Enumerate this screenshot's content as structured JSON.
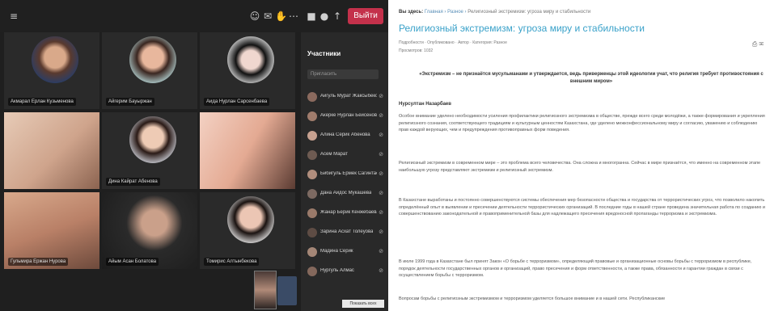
{
  "call": {
    "toolbar": {
      "leave_label": "Выйти"
    },
    "panel": {
      "title": "Участники",
      "search_placeholder": "Пригласить",
      "participants": [
        "Айгуль Мурат Жаксыбекова",
        "Акерке Нурлан Бейсенова",
        "Алина Серик Абенова",
        "Асем Марат",
        "Бибигуль Ермек Сагинтаева",
        "Дана Айдос Мукашева",
        "Жанар Берик Кенжебаева",
        "Зарина Асхат Толеуова",
        "Мадина Серик",
        "Нургуль Алмас"
      ]
    },
    "tiles": [
      "Акмарал Ерлан Кузьменова",
      "Айгерим Бауыржан",
      "Аида Нурлан Сарсенбаева",
      "",
      "Дина Кайрат Абенова",
      "",
      "Гульмира Ержан Нурова",
      "Айым Асан Болатова",
      "Томирис Алтынбекова"
    ],
    "tooltip": "Показать всех"
  },
  "article": {
    "breadcrumb": [
      "Вы здесь:",
      "Главная",
      "Разное",
      "Религиозный экстремизм: угроза миру и стабильности"
    ],
    "title": "Религиозный экстремизм: угроза миру и стабильности",
    "meta": "Подробности · Опубликовано · Автор · Категория: Разное",
    "views": "Просмотров: 1032",
    "abstract": "«Экстремизм – не признаётся мусульманами и утверждается, ведь приверженцы этой идеологии учат, что религия требует противостояния с внешним миром»",
    "author": "Нурсултан Назарбаев",
    "paragraphs": [
      "Особое внимание уделено необходимости усиления профилактики религиозного экстремизма в обществе, прежде всего среди молодёжи, а также формирования и укрепления религиозного сознания, соответствующего традициям и культурным ценностям Казахстана, где уделено межконфессиональному миру и согласию, уважению и соблюдению прав каждой верующих, чем и предупреждения противоправных форм поведения.",
      "Религиозный экстремизм в современном мире – это проблема всего человечества. Она сложна и многогранна. Сейчас в мире признаётся, что именно на современном этапе наибольшую угрозу представляют экстремизм и религиозный экстремизм.",
      "В Казахстане выработаны и постоянно совершенствуются системы обеспечения мер безопасности общества и государства от террористических угроз, что позволило накопить определённый опыт в выявлении и пресечении деятельности террористических организаций. В последние годы в нашей стране проведена значительная работа по созданию и совершенствованию законодательной и правоприменительной базы для надлежащего пресечения вредоносной пропаганды терроризма и экстремизма.",
      "В июле 1999 года в Казахстане был принят Закон «О борьбе с терроризмом», определяющий правовые и организационные основы борьбы с терроризмом в республике, порядок деятельности государственных органов и организаций, право пресечения и форм ответственности, а также права, обязанности и гарантии граждан в связи с осуществлением борьбы с терроризмом.",
      "Вопросам борьбы с религиозным экстремизмом и терроризмом уделяется большое внимание и в нашей сети. Республиканские"
    ]
  },
  "colors": {
    "accent": "#39a1c9",
    "leave": "#c4314b",
    "call_bg": "#1f1f1f"
  }
}
